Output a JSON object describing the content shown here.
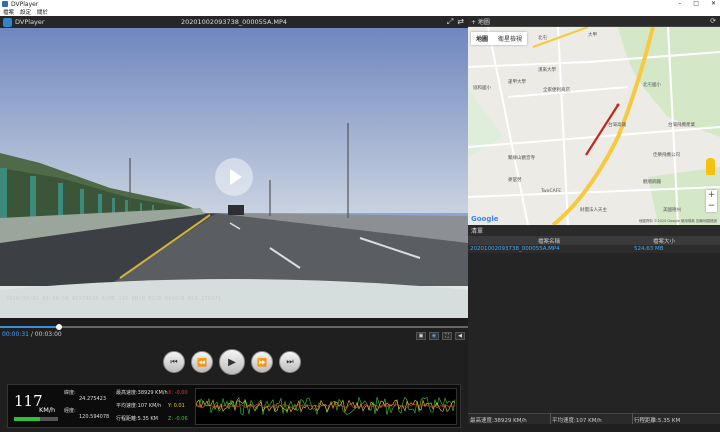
{
  "window": {
    "title": "DVPlayer",
    "minimize": "–",
    "maximize": "□",
    "close": "✕"
  },
  "menu": [
    "檔案",
    "設定",
    "關於"
  ],
  "video_header": {
    "app_name": "DVPlayer",
    "file_name": "20201002093738_000055A.MP4"
  },
  "video": {
    "overlay": "2020/10/02  09:38:58   NEXTBASE  A1HD   116 KM/H  E120.594078  N24.275071"
  },
  "playback": {
    "current": "00:00:31",
    "separator": " / ",
    "total": "00:03:00",
    "progress": 0.125
  },
  "dashboard": {
    "speed": "117",
    "speed_unit": "KM/h",
    "speed_level": 0.6,
    "lat_label": "緯度:",
    "lat_value": "24.275423",
    "lon_label": "經度:",
    "lon_value": "120.594078",
    "max_speed": "最高速度:38929 KM/h",
    "avg_speed": "平均速度:107 KM/h",
    "distance": "行程距離:5.35 KM",
    "gx": "X: -0.00",
    "gy": "Y: 0.01",
    "gz": "Z: -0.06"
  },
  "map_panel": {
    "header": "+ 地圖",
    "map_tab": "地圖",
    "satellite_tab": "衛星檢視",
    "zoom_in": "+",
    "zoom_out": "−",
    "google": "Google",
    "attribution": "地圖資料 ©2020 Google  使用條款  回報地圖錯誤",
    "labels": [
      "北屯",
      "逢甲大學",
      "漢來大學",
      "全家便利商店",
      "台灣高鐵",
      "聚緣山觀音寺",
      "TwoCAFE",
      "麥當勞",
      "財團法人天主",
      "協和國小",
      "大甲",
      "北屯國小",
      "台灣飛機產業",
      "佳樂飛機公司",
      "觀順鋼鐵",
      "美國德州"
    ]
  },
  "file_list": {
    "header": "清單",
    "col_name": "檔案名稱",
    "col_size": "檔案大小",
    "rows": [
      {
        "name": "20201002093738_000055A.MP4",
        "size": "524.63 MB"
      }
    ]
  },
  "statusbar": {
    "max": "最高速度:38929 KM/h",
    "avg": "平均速度:107 KM/h",
    "dist": "行程距離:5.35 KM"
  },
  "colors": {
    "accent": "#3fa9f5",
    "route": "#c0271a",
    "speed_ok": "#2fbf3a"
  }
}
